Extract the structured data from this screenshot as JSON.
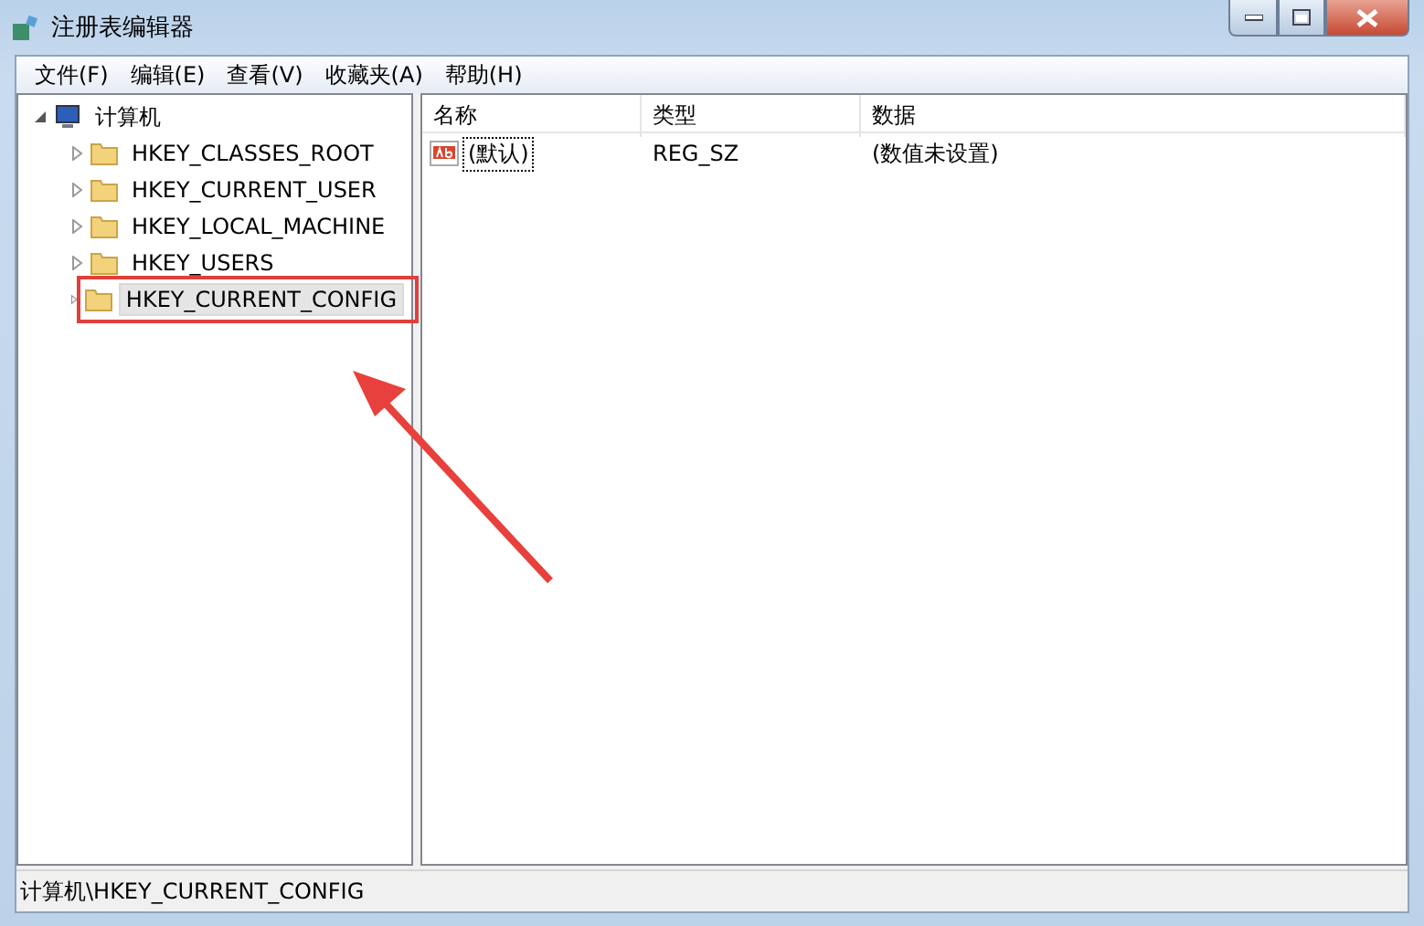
{
  "window": {
    "title": "注册表编辑器"
  },
  "menu": [
    "文件(F)",
    "编辑(E)",
    "查看(V)",
    "收藏夹(A)",
    "帮助(H)"
  ],
  "tree": {
    "label": "计算机",
    "expanded": true,
    "selected": false,
    "children": [
      {
        "label": "HKEY_CLASSES_ROOT",
        "expanded": false,
        "selected": false,
        "highlighted": false
      },
      {
        "label": "HKEY_CURRENT_USER",
        "expanded": false,
        "selected": false,
        "highlighted": false
      },
      {
        "label": "HKEY_LOCAL_MACHINE",
        "expanded": false,
        "selected": false,
        "highlighted": false
      },
      {
        "label": "HKEY_USERS",
        "expanded": false,
        "selected": false,
        "highlighted": false
      },
      {
        "label": "HKEY_CURRENT_CONFIG",
        "expanded": false,
        "selected": true,
        "highlighted": true
      }
    ]
  },
  "table": {
    "columns": [
      "名称",
      "类型",
      "数据"
    ],
    "rows": [
      {
        "name": "(默认)",
        "type": "REG_SZ",
        "data": "(数值未设置)",
        "focused": true
      }
    ]
  },
  "status_bar": "计算机\\HKEY_CURRENT_CONFIG"
}
